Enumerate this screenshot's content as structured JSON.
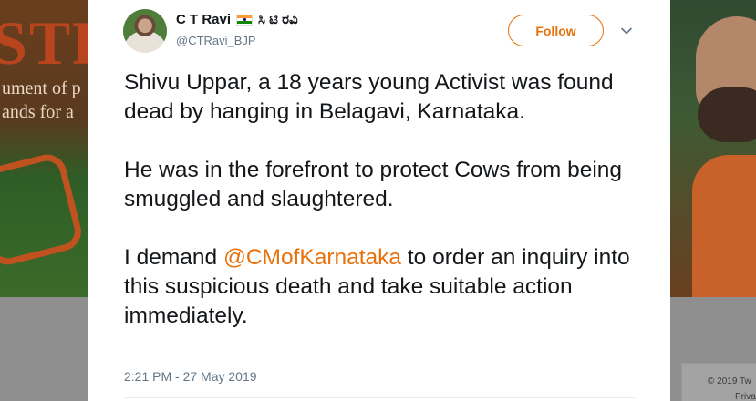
{
  "background": {
    "left_banner_title": "STR",
    "left_banner_line1": "ument of p",
    "left_banner_line2": "ands for a",
    "footer_copyright": "© 2019 Tw",
    "footer_privacy": "Priva"
  },
  "tweet": {
    "display_name": "C T Ravi",
    "kannada_name": "ಸಿ ಟಿ ರವಿ",
    "handle": "@CTRavi_BJP",
    "follow_label": "Follow",
    "paragraph1": "Shivu Uppar, a 18 years young Activist was found dead by hanging in Belagavi, Karnataka.",
    "paragraph2": "He was in the forefront to protect Cows from being smuggled and slaughtered.",
    "paragraph3_before": "I demand ",
    "paragraph3_mention": "@CMofKarnataka",
    "paragraph3_after": " to order an inquiry into this suspicious death and take suitable action immediately.",
    "timestamp": "2:21 PM - 27 May 2019"
  },
  "colors": {
    "accent": "#e8710a",
    "text": "#14171a",
    "secondary_text": "#657786"
  },
  "icons": {
    "flag": "india-flag-icon",
    "menu": "chevron-down-icon"
  }
}
